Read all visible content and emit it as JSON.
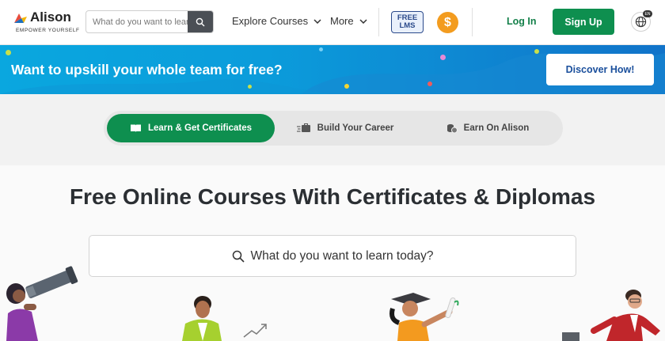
{
  "header": {
    "logo_name": "Alison",
    "logo_tagline": "EMPOWER YOURSELF",
    "search_placeholder": "What do you want to learn",
    "nav": [
      {
        "label": "Explore Courses"
      },
      {
        "label": "More"
      }
    ],
    "lms_badge": [
      "FREE",
      "LMS"
    ],
    "dollar_symbol": "$",
    "login_label": "Log In",
    "signup_label": "Sign Up",
    "globe_badge": "EN"
  },
  "banner": {
    "text": "Want to upskill your whole team for free?",
    "cta_label": "Discover How!"
  },
  "tabs": [
    {
      "label": "Learn & Get Certificates",
      "icon": "book-icon",
      "active": true
    },
    {
      "label": "Build Your Career",
      "icon": "briefcase-icon",
      "active": false
    },
    {
      "label": "Earn On Alison",
      "icon": "coins-icon",
      "active": false
    }
  ],
  "main": {
    "headline": "Free Online Courses With Certificates & Diplomas",
    "search_placeholder": "What do you want to learn today?"
  },
  "colors": {
    "brand_green": "#0e8f4f",
    "banner_blue": "#0aa7df",
    "lms_blue": "#2b4a8b",
    "dollar_orange": "#f39c1f"
  }
}
